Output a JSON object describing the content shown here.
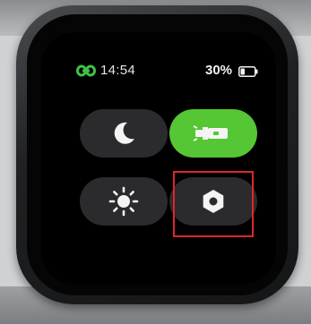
{
  "status_bar": {
    "time": "14:54",
    "battery_percent": "30%",
    "battery_level": 0.3,
    "connection_icon": "link-icon",
    "connection_color": "#3fc24a"
  },
  "quick_settings": {
    "tiles": [
      {
        "name": "do-not-disturb",
        "icon": "moon-icon",
        "active": false
      },
      {
        "name": "flashlight",
        "icon": "flashlight-icon",
        "active": true
      },
      {
        "name": "brightness",
        "icon": "sun-icon",
        "active": false
      },
      {
        "name": "settings",
        "icon": "hex-nut-icon",
        "active": false,
        "highlighted": true
      }
    ],
    "active_color": "#55c634",
    "inactive_color": "#2b2b2d",
    "highlight_color": "#e0252b"
  }
}
